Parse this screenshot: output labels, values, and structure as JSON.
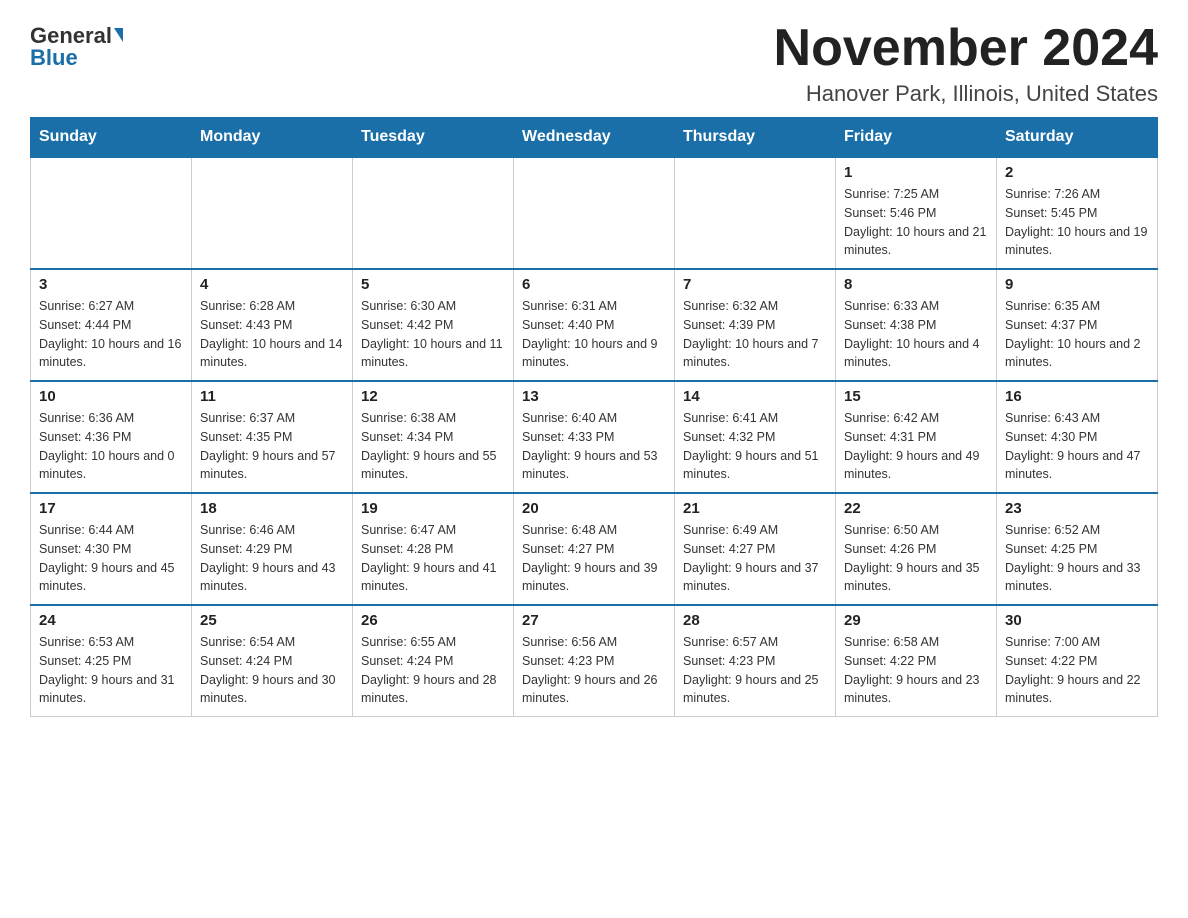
{
  "logo": {
    "general": "General",
    "blue": "Blue"
  },
  "title": {
    "month_year": "November 2024",
    "location": "Hanover Park, Illinois, United States"
  },
  "weekdays": [
    "Sunday",
    "Monday",
    "Tuesday",
    "Wednesday",
    "Thursday",
    "Friday",
    "Saturday"
  ],
  "weeks": [
    [
      {
        "day": "",
        "info": ""
      },
      {
        "day": "",
        "info": ""
      },
      {
        "day": "",
        "info": ""
      },
      {
        "day": "",
        "info": ""
      },
      {
        "day": "",
        "info": ""
      },
      {
        "day": "1",
        "info": "Sunrise: 7:25 AM\nSunset: 5:46 PM\nDaylight: 10 hours and 21 minutes."
      },
      {
        "day": "2",
        "info": "Sunrise: 7:26 AM\nSunset: 5:45 PM\nDaylight: 10 hours and 19 minutes."
      }
    ],
    [
      {
        "day": "3",
        "info": "Sunrise: 6:27 AM\nSunset: 4:44 PM\nDaylight: 10 hours and 16 minutes."
      },
      {
        "day": "4",
        "info": "Sunrise: 6:28 AM\nSunset: 4:43 PM\nDaylight: 10 hours and 14 minutes."
      },
      {
        "day": "5",
        "info": "Sunrise: 6:30 AM\nSunset: 4:42 PM\nDaylight: 10 hours and 11 minutes."
      },
      {
        "day": "6",
        "info": "Sunrise: 6:31 AM\nSunset: 4:40 PM\nDaylight: 10 hours and 9 minutes."
      },
      {
        "day": "7",
        "info": "Sunrise: 6:32 AM\nSunset: 4:39 PM\nDaylight: 10 hours and 7 minutes."
      },
      {
        "day": "8",
        "info": "Sunrise: 6:33 AM\nSunset: 4:38 PM\nDaylight: 10 hours and 4 minutes."
      },
      {
        "day": "9",
        "info": "Sunrise: 6:35 AM\nSunset: 4:37 PM\nDaylight: 10 hours and 2 minutes."
      }
    ],
    [
      {
        "day": "10",
        "info": "Sunrise: 6:36 AM\nSunset: 4:36 PM\nDaylight: 10 hours and 0 minutes."
      },
      {
        "day": "11",
        "info": "Sunrise: 6:37 AM\nSunset: 4:35 PM\nDaylight: 9 hours and 57 minutes."
      },
      {
        "day": "12",
        "info": "Sunrise: 6:38 AM\nSunset: 4:34 PM\nDaylight: 9 hours and 55 minutes."
      },
      {
        "day": "13",
        "info": "Sunrise: 6:40 AM\nSunset: 4:33 PM\nDaylight: 9 hours and 53 minutes."
      },
      {
        "day": "14",
        "info": "Sunrise: 6:41 AM\nSunset: 4:32 PM\nDaylight: 9 hours and 51 minutes."
      },
      {
        "day": "15",
        "info": "Sunrise: 6:42 AM\nSunset: 4:31 PM\nDaylight: 9 hours and 49 minutes."
      },
      {
        "day": "16",
        "info": "Sunrise: 6:43 AM\nSunset: 4:30 PM\nDaylight: 9 hours and 47 minutes."
      }
    ],
    [
      {
        "day": "17",
        "info": "Sunrise: 6:44 AM\nSunset: 4:30 PM\nDaylight: 9 hours and 45 minutes."
      },
      {
        "day": "18",
        "info": "Sunrise: 6:46 AM\nSunset: 4:29 PM\nDaylight: 9 hours and 43 minutes."
      },
      {
        "day": "19",
        "info": "Sunrise: 6:47 AM\nSunset: 4:28 PM\nDaylight: 9 hours and 41 minutes."
      },
      {
        "day": "20",
        "info": "Sunrise: 6:48 AM\nSunset: 4:27 PM\nDaylight: 9 hours and 39 minutes."
      },
      {
        "day": "21",
        "info": "Sunrise: 6:49 AM\nSunset: 4:27 PM\nDaylight: 9 hours and 37 minutes."
      },
      {
        "day": "22",
        "info": "Sunrise: 6:50 AM\nSunset: 4:26 PM\nDaylight: 9 hours and 35 minutes."
      },
      {
        "day": "23",
        "info": "Sunrise: 6:52 AM\nSunset: 4:25 PM\nDaylight: 9 hours and 33 minutes."
      }
    ],
    [
      {
        "day": "24",
        "info": "Sunrise: 6:53 AM\nSunset: 4:25 PM\nDaylight: 9 hours and 31 minutes."
      },
      {
        "day": "25",
        "info": "Sunrise: 6:54 AM\nSunset: 4:24 PM\nDaylight: 9 hours and 30 minutes."
      },
      {
        "day": "26",
        "info": "Sunrise: 6:55 AM\nSunset: 4:24 PM\nDaylight: 9 hours and 28 minutes."
      },
      {
        "day": "27",
        "info": "Sunrise: 6:56 AM\nSunset: 4:23 PM\nDaylight: 9 hours and 26 minutes."
      },
      {
        "day": "28",
        "info": "Sunrise: 6:57 AM\nSunset: 4:23 PM\nDaylight: 9 hours and 25 minutes."
      },
      {
        "day": "29",
        "info": "Sunrise: 6:58 AM\nSunset: 4:22 PM\nDaylight: 9 hours and 23 minutes."
      },
      {
        "day": "30",
        "info": "Sunrise: 7:00 AM\nSunset: 4:22 PM\nDaylight: 9 hours and 22 minutes."
      }
    ]
  ]
}
